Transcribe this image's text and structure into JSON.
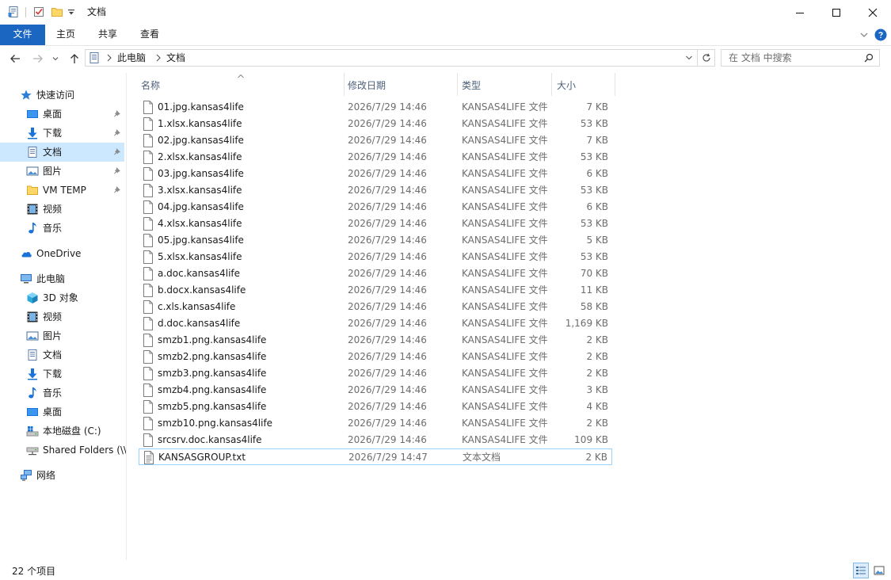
{
  "window": {
    "title": "文档",
    "minimize_icon": "minimize-icon",
    "maximize_icon": "maximize-icon",
    "close_icon": "close-icon"
  },
  "quick_access_toolbar": {
    "icons": [
      "document-properties-icon",
      "checkmark-icon",
      "new-folder-icon",
      "customize-dropdown-icon"
    ]
  },
  "ribbon": {
    "tabs": [
      "文件",
      "主页",
      "共享",
      "查看"
    ],
    "active_tab": "文件",
    "accent_color": "#1a66c1",
    "expand_icon": "chevron-down-icon",
    "help_icon": "help-icon"
  },
  "address_bar": {
    "back_icon": "back-arrow-icon",
    "forward_icon": "forward-arrow-icon",
    "recent_icon": "chevron-down-icon",
    "up_icon": "up-arrow-icon",
    "breadcrumbs": [
      "此电脑",
      "文档"
    ],
    "refresh_icon": "refresh-icon"
  },
  "search": {
    "placeholder": "在 文档 中搜索",
    "value": ""
  },
  "nav_pane": {
    "quick_access_label": "快速访问",
    "quick_access_items": [
      {
        "label": "桌面",
        "icon": "desktop-icon",
        "pinned": true
      },
      {
        "label": "下载",
        "icon": "download-icon",
        "pinned": true
      },
      {
        "label": "文档",
        "icon": "documents-icon",
        "pinned": true,
        "selected": true
      },
      {
        "label": "图片",
        "icon": "pictures-icon",
        "pinned": true
      },
      {
        "label": "VM TEMP",
        "icon": "folder-icon",
        "pinned": true
      },
      {
        "label": "视频",
        "icon": "videos-icon",
        "pinned": false
      },
      {
        "label": "音乐",
        "icon": "music-icon",
        "pinned": false
      }
    ],
    "onedrive_label": "OneDrive",
    "this_pc_label": "此电脑",
    "this_pc_items": [
      {
        "label": "3D 对象",
        "icon": "3d-objects-icon"
      },
      {
        "label": "视频",
        "icon": "videos-icon"
      },
      {
        "label": "图片",
        "icon": "pictures-icon"
      },
      {
        "label": "文档",
        "icon": "documents-icon"
      },
      {
        "label": "下载",
        "icon": "download-icon"
      },
      {
        "label": "音乐",
        "icon": "music-icon"
      },
      {
        "label": "桌面",
        "icon": "desktop-icon"
      },
      {
        "label": "本地磁盘 (C:)",
        "icon": "local-disk-icon"
      },
      {
        "label": "Shared Folders (\\\\",
        "icon": "network-drive-icon"
      }
    ],
    "network_label": "网络"
  },
  "file_list": {
    "columns": [
      "名称",
      "修改日期",
      "类型",
      "大小"
    ],
    "sort_column": "名称",
    "rows": [
      {
        "name": "01.jpg.kansas4life",
        "date": "2026/7/29 14:46",
        "type": "KANSAS4LIFE 文件",
        "size": "7 KB"
      },
      {
        "name": "1.xlsx.kansas4life",
        "date": "2026/7/29 14:46",
        "type": "KANSAS4LIFE 文件",
        "size": "53 KB"
      },
      {
        "name": "02.jpg.kansas4life",
        "date": "2026/7/29 14:46",
        "type": "KANSAS4LIFE 文件",
        "size": "7 KB"
      },
      {
        "name": "2.xlsx.kansas4life",
        "date": "2026/7/29 14:46",
        "type": "KANSAS4LIFE 文件",
        "size": "53 KB"
      },
      {
        "name": "03.jpg.kansas4life",
        "date": "2026/7/29 14:46",
        "type": "KANSAS4LIFE 文件",
        "size": "6 KB"
      },
      {
        "name": "3.xlsx.kansas4life",
        "date": "2026/7/29 14:46",
        "type": "KANSAS4LIFE 文件",
        "size": "53 KB"
      },
      {
        "name": "04.jpg.kansas4life",
        "date": "2026/7/29 14:46",
        "type": "KANSAS4LIFE 文件",
        "size": "6 KB"
      },
      {
        "name": "4.xlsx.kansas4life",
        "date": "2026/7/29 14:46",
        "type": "KANSAS4LIFE 文件",
        "size": "53 KB"
      },
      {
        "name": "05.jpg.kansas4life",
        "date": "2026/7/29 14:46",
        "type": "KANSAS4LIFE 文件",
        "size": "5 KB"
      },
      {
        "name": "5.xlsx.kansas4life",
        "date": "2026/7/29 14:46",
        "type": "KANSAS4LIFE 文件",
        "size": "53 KB"
      },
      {
        "name": "a.doc.kansas4life",
        "date": "2026/7/29 14:46",
        "type": "KANSAS4LIFE 文件",
        "size": "70 KB"
      },
      {
        "name": "b.docx.kansas4life",
        "date": "2026/7/29 14:46",
        "type": "KANSAS4LIFE 文件",
        "size": "11 KB"
      },
      {
        "name": "c.xls.kansas4life",
        "date": "2026/7/29 14:46",
        "type": "KANSAS4LIFE 文件",
        "size": "58 KB"
      },
      {
        "name": "d.doc.kansas4life",
        "date": "2026/7/29 14:46",
        "type": "KANSAS4LIFE 文件",
        "size": "1,169 KB"
      },
      {
        "name": "smzb1.png.kansas4life",
        "date": "2026/7/29 14:46",
        "type": "KANSAS4LIFE 文件",
        "size": "2 KB"
      },
      {
        "name": "smzb2.png.kansas4life",
        "date": "2026/7/29 14:46",
        "type": "KANSAS4LIFE 文件",
        "size": "2 KB"
      },
      {
        "name": "smzb3.png.kansas4life",
        "date": "2026/7/29 14:46",
        "type": "KANSAS4LIFE 文件",
        "size": "2 KB"
      },
      {
        "name": "smzb4.png.kansas4life",
        "date": "2026/7/29 14:46",
        "type": "KANSAS4LIFE 文件",
        "size": "3 KB"
      },
      {
        "name": "smzb5.png.kansas4life",
        "date": "2026/7/29 14:46",
        "type": "KANSAS4LIFE 文件",
        "size": "4 KB"
      },
      {
        "name": "smzb10.png.kansas4life",
        "date": "2026/7/29 14:46",
        "type": "KANSAS4LIFE 文件",
        "size": "2 KB"
      },
      {
        "name": "srcsrv.doc.kansas4life",
        "date": "2026/7/29 14:46",
        "type": "KANSAS4LIFE 文件",
        "size": "109 KB"
      },
      {
        "name": "KANSASGROUP.txt",
        "date": "2026/7/29 14:47",
        "type": "文本文档",
        "size": "2 KB",
        "focused": true,
        "icon": "text-file-icon"
      }
    ]
  },
  "status_bar": {
    "item_count": "22 个项目",
    "details_view_icon": "details-view-icon",
    "large_icons_view_icon": "large-icons-view-icon"
  }
}
